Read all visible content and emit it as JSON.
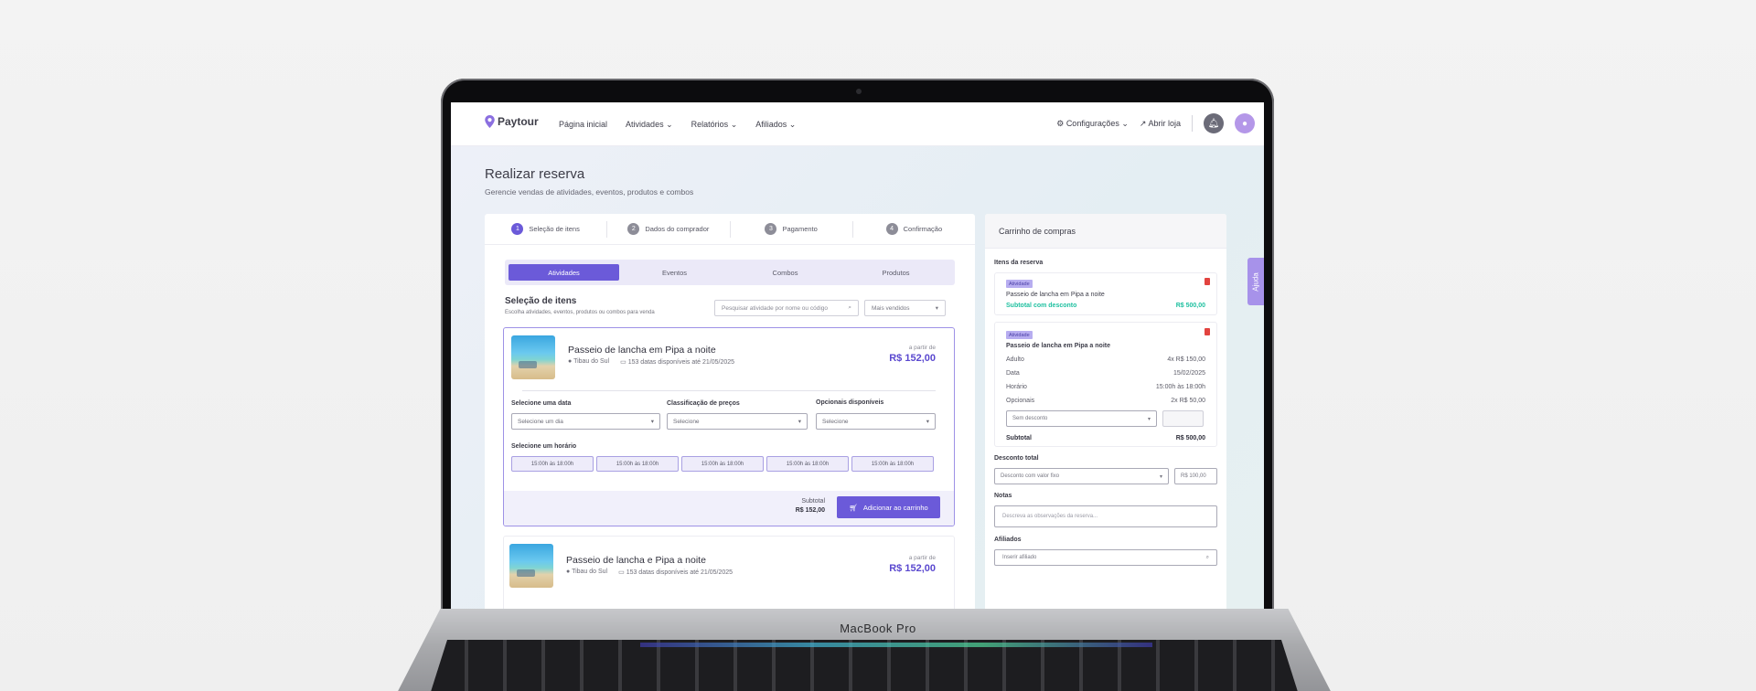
{
  "device": {
    "brand_label": "MacBook Pro"
  },
  "nav": {
    "logo": "Paytour",
    "links": [
      "Página inicial",
      "Atividades",
      "Relatórios",
      "Afiliados"
    ],
    "settings": "Configurações",
    "open_store": "Abrir loja"
  },
  "page": {
    "title": "Realizar reserva",
    "subtitle": "Gerencie vendas de atividades, eventos, produtos e combos"
  },
  "steps": [
    {
      "num": "1",
      "label": "Seleção de itens",
      "active": true
    },
    {
      "num": "2",
      "label": "Dados do comprador",
      "active": false
    },
    {
      "num": "3",
      "label": "Pagamento",
      "active": false
    },
    {
      "num": "4",
      "label": "Confirmação",
      "active": false
    }
  ],
  "tabs": [
    "Atividades",
    "Eventos",
    "Combos",
    "Produtos"
  ],
  "selection": {
    "title": "Seleção de itens",
    "subtitle": "Escolha atividades, eventos, produtos ou combos para venda",
    "search_placeholder": "Pesquisar atividade por nome ou código",
    "sort": "Mais vendidos"
  },
  "product1": {
    "name": "Passeio de lancha em Pipa a noite",
    "location": "Tibau do Sul",
    "dates": "153 datas disponíveis até 21/05/2025",
    "from_label": "a partir de",
    "price": "R$ 152,00",
    "date_label": "Selecione uma data",
    "date_value": "Selecione um dia",
    "price_class_label": "Classificação de preços",
    "price_class_value": "Selecione",
    "optionals_label": "Opcionais disponíveis",
    "optionals_value": "Selecione",
    "time_label": "Selecione um horário",
    "slots": [
      "15:00h às 18:00h",
      "15:00h às 18:00h",
      "15:00h às 18:00h",
      "15:00h às 18:00h",
      "15:00h às 18:00h"
    ],
    "subtotal_label": "Subtotal",
    "subtotal_value": "R$ 152,00",
    "add_button": "Adicionar ao carrinho"
  },
  "product2": {
    "name": "Passeio de lancha e Pipa a noite",
    "location": "Tibau do Sul",
    "dates": "153 datas disponíveis até 21/05/2025",
    "from_label": "a partir de",
    "price": "R$ 152,00"
  },
  "cart": {
    "title": "Carrinho de compras",
    "items_label": "Itens da reserva",
    "item1": {
      "badge": "Atividade",
      "name": "Passeio de lancha em Pipa a noite",
      "subtotal_label": "Subtotal com desconto",
      "subtotal_value": "R$ 500,00"
    },
    "item2": {
      "badge": "Atividade",
      "name": "Passeio de lancha em Pipa a noite",
      "rows": [
        {
          "k": "Adulto",
          "v": "4x R$ 150,00"
        },
        {
          "k": "Data",
          "v": "15/02/2025"
        },
        {
          "k": "Horário",
          "v": "15:00h às 18:00h"
        },
        {
          "k": "Opcionais",
          "v": "2x R$ 50,00"
        }
      ],
      "discount": "Sem desconto",
      "subtotal_label": "Subtotal",
      "subtotal_value": "R$ 500,00"
    },
    "total_discount_label": "Desconto total",
    "total_discount_type": "Desconto com valor fixo",
    "total_discount_value": "R$ 100,00",
    "notes_label": "Notas",
    "notes_placeholder": "Descreva as observações da reserva...",
    "affiliates_label": "Afiliados",
    "affiliates_placeholder": "Inserir afiliado"
  },
  "help": "Ajuda",
  "colors": {
    "accent": "#6b5ad9",
    "teal": "#1fc0a0",
    "danger": "#e2433f"
  }
}
